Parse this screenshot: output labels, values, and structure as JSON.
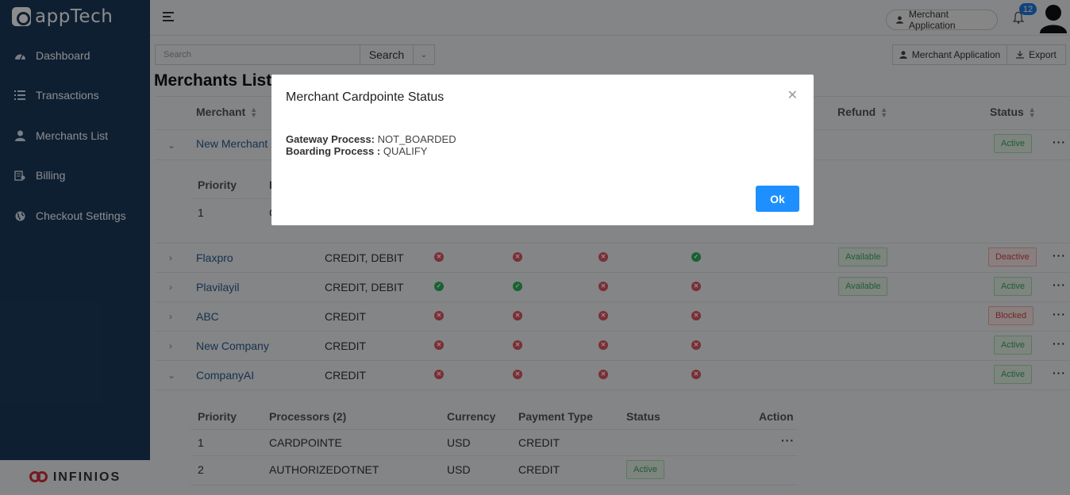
{
  "app": {
    "logo_text": "appTech",
    "footer_brand": "INFINIOS"
  },
  "sidebar": {
    "items": [
      {
        "label": "Dashboard",
        "icon": "dashboard-icon"
      },
      {
        "label": "Transactions",
        "icon": "list-icon"
      },
      {
        "label": "Merchants List",
        "icon": "user-icon"
      },
      {
        "label": "Billing",
        "icon": "billing-icon"
      },
      {
        "label": "Checkout Settings",
        "icon": "globe-icon"
      }
    ]
  },
  "topbar": {
    "merchant_app_label": "Merchant Application",
    "notifications_count": "12"
  },
  "toolbar": {
    "search_placeholder": "Search",
    "search_button": "Search",
    "merchant_app_button": "Merchant Application",
    "export_button": "Export"
  },
  "page": {
    "title": "Merchants List"
  },
  "table": {
    "headers": {
      "merchant": "Merchant",
      "refund": "Refund",
      "status": "Status"
    },
    "rows": [
      {
        "name": "New Merchant X",
        "expanded": true,
        "status": "Active",
        "status_color": "green"
      },
      {
        "name": "Flaxpro",
        "products": "CREDIT, DEBIT",
        "icons": [
          "x",
          "x",
          "x",
          "ok"
        ],
        "refund": "Available",
        "status": "Deactive",
        "status_color": "red"
      },
      {
        "name": "Plavilayil",
        "products": "CREDIT, DEBIT",
        "icons": [
          "ok",
          "ok",
          "x",
          "x"
        ],
        "refund": "Available",
        "status": "Active",
        "status_color": "green"
      },
      {
        "name": "ABC",
        "products": "CREDIT",
        "icons": [
          "x",
          "x",
          "x",
          "x"
        ],
        "refund": "",
        "status": "Blocked",
        "status_color": "red"
      },
      {
        "name": "New Company",
        "products": "CREDIT",
        "icons": [
          "x",
          "x",
          "x",
          "x"
        ],
        "refund": "",
        "status": "Active",
        "status_color": "green"
      },
      {
        "name": "CompanyAI",
        "products": "CREDIT",
        "icons": [
          "x",
          "x",
          "x",
          "x"
        ],
        "refund": "",
        "status": "Active",
        "status_color": "green"
      }
    ],
    "first_sub": {
      "priority_header": "Priority",
      "row_priority": "1"
    },
    "sub_table": {
      "headers": {
        "priority": "Priority",
        "processors": "Processors (2)",
        "currency": "Currency",
        "payment_type": "Payment Type",
        "status": "Status",
        "action": "Action"
      },
      "rows": [
        {
          "priority": "1",
          "processor": "CARDPOINTE",
          "currency": "USD",
          "payment_type": "CREDIT",
          "status": ""
        },
        {
          "priority": "2",
          "processor": "AUTHORIZEDOTNET",
          "currency": "USD",
          "payment_type": "CREDIT",
          "status": "Active"
        }
      ]
    }
  },
  "modal": {
    "title": "Merchant Cardpointe Status",
    "gateway_label": "Gateway Process:",
    "gateway_value": "NOT_BOARDED",
    "boarding_label": "Boarding Process :",
    "boarding_value": "QUALIFY",
    "ok_button": "Ok"
  },
  "colors": {
    "sidebar_bg": "#1b3a5c",
    "primary_button": "#1e8fff",
    "badge": "#1e7ae0",
    "error": "#e05461",
    "success": "#2eb259"
  }
}
